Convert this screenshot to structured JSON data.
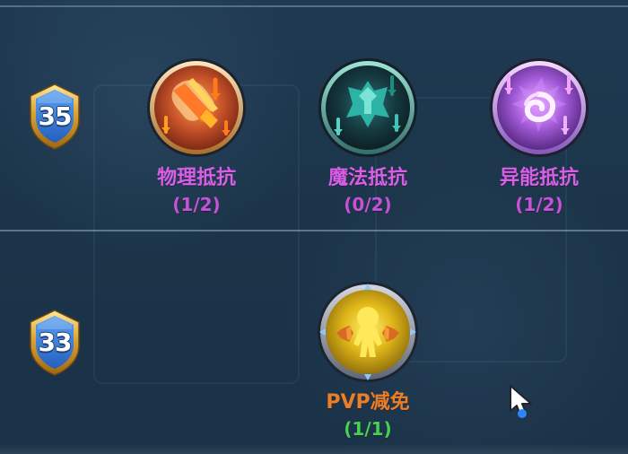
{
  "rows": [
    {
      "level_badge": {
        "value": "35"
      },
      "skills": [
        {
          "name": "物理抵抗",
          "progress": "(1/2)",
          "icon": "physical-resistance-icon",
          "accent_color": "#d85fe5"
        },
        {
          "name": "魔法抵抗",
          "progress": "(0/2)",
          "icon": "magic-resistance-icon",
          "accent_color": "#d85fe5"
        },
        {
          "name": "异能抵抗",
          "progress": "(1/2)",
          "icon": "psionic-resistance-icon",
          "accent_color": "#d85fe5"
        }
      ]
    },
    {
      "level_badge": {
        "value": "33"
      },
      "skills": [
        {
          "name": "PVP减免",
          "progress": "(1/1)",
          "icon": "pvp-reduction-icon",
          "accent_color": "#ea7f25",
          "progress_color": "#48d14e"
        }
      ]
    }
  ],
  "cursor": {
    "icon": "mouse-pointer-icon"
  }
}
